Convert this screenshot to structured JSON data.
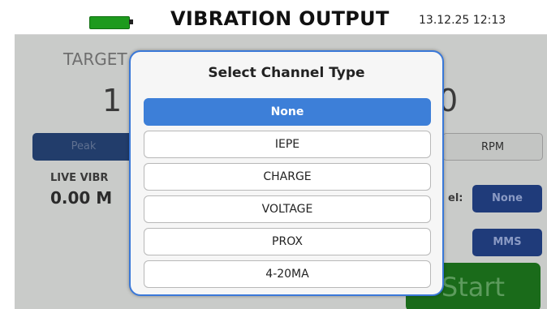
{
  "status": {
    "title": "VIBRATION OUTPUT",
    "datetime": "13.12.25 12:13",
    "battery_icon": "battery-icon",
    "battery_color": "#1d9a1d"
  },
  "background": {
    "target_label": "TARGET",
    "target_value_left": "1",
    "target_value_right": "0",
    "peak_button": "Peak",
    "rpm_button": "RPM",
    "live_label": "LIVE VIBR",
    "live_value": "0.00 M",
    "channel_label_tail": "el:",
    "channel_button": "None",
    "units_button": "MMS",
    "start_button": "Start"
  },
  "dialog": {
    "title": "Select Channel Type",
    "selected_index": 0,
    "options": [
      "None",
      "IEPE",
      "CHARGE",
      "VOLTAGE",
      "PROX",
      "4-20MA"
    ]
  },
  "colors": {
    "accent": "#3d7fd8",
    "start_green": "#1a6b1a"
  }
}
